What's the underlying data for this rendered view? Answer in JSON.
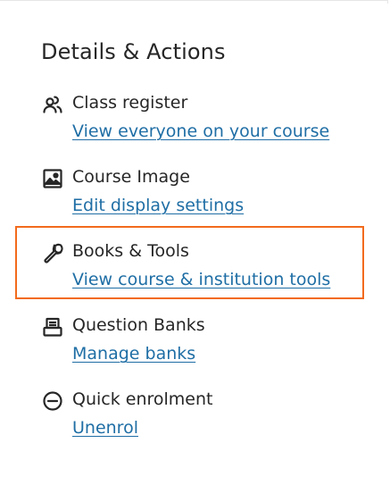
{
  "panel": {
    "title": "Details & Actions"
  },
  "items": [
    {
      "icon": "users-icon",
      "title": "Class register",
      "link": "View everyone on your course"
    },
    {
      "icon": "image-icon",
      "title": "Course Image",
      "link": "Edit display settings"
    },
    {
      "icon": "wrench-icon",
      "title": "Books & Tools",
      "link": "View course & institution tools"
    },
    {
      "icon": "question-bank-icon",
      "title": "Question Banks",
      "link": "Manage banks"
    },
    {
      "icon": "minus-circle-icon",
      "title": "Quick enrolment",
      "link": "Unenrol"
    }
  ],
  "colors": {
    "link": "#1f6ea5",
    "text": "#262626",
    "highlight": "#f26b1d"
  }
}
